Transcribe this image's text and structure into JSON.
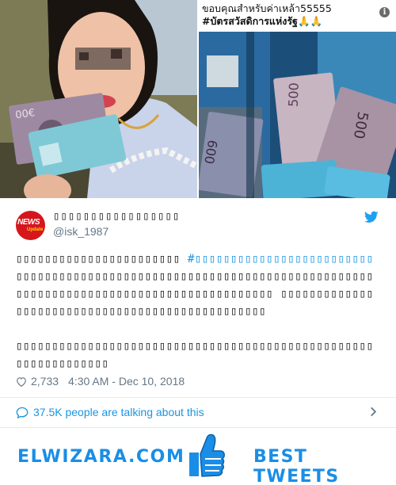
{
  "photo": {
    "caption_line1": "ขอบคุณสำหรับค่าเหล้า55555",
    "caption_line2": "#บัตรสวัสดิการแห่งรัฐ🙏🙏"
  },
  "tweet": {
    "display_name": "▯▯▯▯▯▯▯▯▯▯▯▯▯▯▯▯▯",
    "handle": "@isk_1987",
    "avatar_text": "NEWS",
    "avatar_subtext": "Update",
    "text_part1": "▯▯▯▯▯▯▯▯▯▯▯▯▯▯▯▯▯▯▯▯▯▯▯ ",
    "hashtag": "#▯▯▯▯▯▯▯▯▯▯▯▯▯▯▯▯▯▯▯▯▯▯▯▯▯",
    "text_part2": " ▯▯▯▯▯▯▯▯▯▯▯▯▯▯▯▯▯▯▯▯▯▯▯▯▯▯▯▯▯▯▯▯▯▯▯▯▯▯▯▯▯▯▯▯▯▯▯▯▯▯▯▯▯▯▯▯▯▯▯▯▯▯▯▯▯▯▯▯▯▯▯▯▯▯▯▯▯▯▯▯▯▯▯▯▯▯ ▯▯▯▯▯▯▯▯▯▯▯▯▯▯▯▯▯▯▯▯▯▯▯▯▯▯▯▯▯▯▯▯▯▯▯▯▯▯▯▯▯▯▯▯▯▯▯▯",
    "text_para2": "▯▯▯▯▯▯▯▯▯▯▯▯▯▯▯▯▯▯▯▯▯▯▯▯▯▯▯▯▯▯▯▯▯▯▯▯▯▯▯▯▯▯▯▯▯▯▯▯▯▯▯▯▯▯▯▯▯▯▯▯▯▯▯",
    "like_count": "2,733",
    "timestamp": "4:30 AM - Dec 10, 2018",
    "conversation_label": "37.5K people are talking about this"
  },
  "footer": {
    "left_text": "ELWIZARA.COM",
    "right_text": "BEST TWEETS"
  },
  "colors": {
    "link": "#1b95e0",
    "muted": "#657786",
    "brand": "#1a8ee6"
  },
  "icons": [
    "info-icon",
    "twitter-bird-icon",
    "heart-icon",
    "speech-bubble-icon",
    "chevron-right-icon",
    "thumbs-up-icon"
  ]
}
